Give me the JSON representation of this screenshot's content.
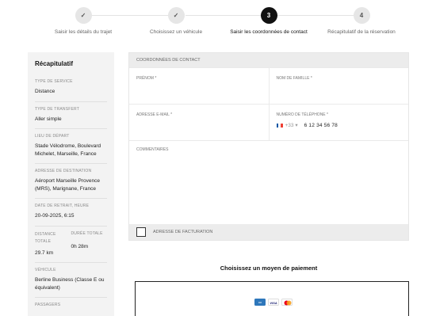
{
  "stepper": {
    "steps": [
      {
        "label": "Saisir les détails du trajet",
        "number": "✓",
        "state": "done"
      },
      {
        "label": "Choisissez un véhicule",
        "number": "✓",
        "state": "done"
      },
      {
        "label": "Saisir les coordonnées de contact",
        "number": "3",
        "state": "active"
      },
      {
        "label": "Récapitulatif de la réservation",
        "number": "4",
        "state": "pending"
      }
    ]
  },
  "summary": {
    "title": "Récapitulatif",
    "service_type_label": "TYPE DE SERVICE",
    "service_type_value": "Distance",
    "transfer_type_label": "TYPE DE TRANSFERT",
    "transfer_type_value": "Aller simple",
    "departure_label": "LIEU DE DÉPART",
    "departure_value": "Stade Vélodrome, Boulevard Michelet, Marseille, France",
    "destination_label": "ADRESSE DE DESTINATION",
    "destination_value": "Aéroport Marseille Provence (MRS), Marignane, France",
    "pickup_label": "DATE DE RETRAIT, HEURE",
    "pickup_value": "20-09-2025, 6:15",
    "distance_label": "DISTANCE TOTALE",
    "distance_value": "29.7 km",
    "duration_label": "DURÉE TOTALE",
    "duration_value": "0h 28m",
    "vehicle_label": "VÉHICULE",
    "vehicle_value": "Berline Business (Classe E ou équivalent)",
    "extra_label": "PASSAGERS"
  },
  "form": {
    "header": "COORDONNÉES DE CONTACT",
    "first_name_label": "PRÉNOM *",
    "last_name_label": "NOM DE FAMILLE *",
    "email_label": "ADRESSE E-MAIL *",
    "phone_label": "NUMÉRO DE TÉLÉPHONE *",
    "phone_dial": "+33 ▾",
    "phone_value": "6 12 34 56 78",
    "comments_label": "COMMENTAIRES",
    "billing_label": "ADRESSE DE FACTURATION"
  },
  "payment": {
    "title": "Choisissez un moyen de paiement",
    "cards": [
      "amex",
      "visa",
      "mastercard"
    ]
  },
  "colors": {
    "accent": "#111111",
    "amex": "#2e77bb",
    "visa": "#1a1f71",
    "mc_red": "#eb001b",
    "mc_orange": "#f79e1b"
  }
}
